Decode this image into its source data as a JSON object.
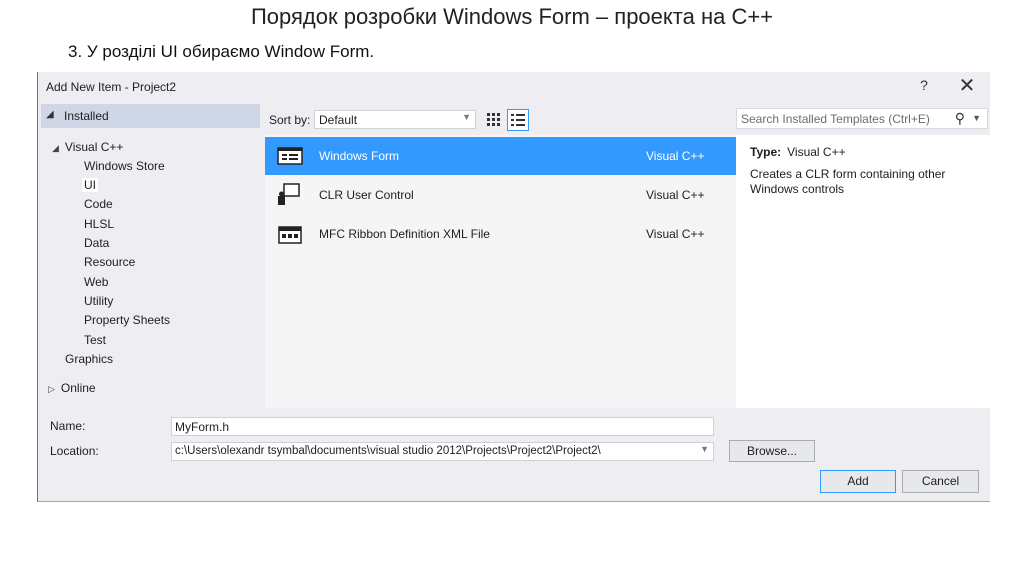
{
  "slide": {
    "title": "Порядок розробки  Windows Form – проекта на С++",
    "subtitle": "3. У розділі UI обираємо Window Form."
  },
  "dialog": {
    "title": "Add New Item - Project2",
    "help": "?",
    "close": "✕"
  },
  "tree": {
    "installed": "Installed",
    "visual_cpp": "Visual C++",
    "children": [
      "Windows Store",
      "UI",
      "Code",
      "HLSL",
      "Data",
      "Resource",
      "Web",
      "Utility",
      "Property Sheets",
      "Test"
    ],
    "graphics": "Graphics",
    "online": "Online",
    "selected": "UI"
  },
  "toolbar": {
    "sort_label": "Sort by:",
    "sort_value": "Default"
  },
  "templates": [
    {
      "name": "Windows Form",
      "lang": "Visual C++",
      "icon": "windows-form-icon",
      "selected": true
    },
    {
      "name": "CLR User Control",
      "lang": "Visual C++",
      "icon": "user-control-icon",
      "selected": false
    },
    {
      "name": "MFC Ribbon Definition XML File",
      "lang": "Visual C++",
      "icon": "ribbon-icon",
      "selected": false
    }
  ],
  "search": {
    "placeholder": "Search Installed Templates (Ctrl+E)"
  },
  "details": {
    "type_label": "Type:",
    "type_value": "Visual C++",
    "description": "Creates a CLR form containing other Windows controls"
  },
  "form": {
    "name_label": "Name:",
    "name_value": "MyForm.h",
    "location_label": "Location:",
    "location_value": "c:\\Users\\olexandr tsymbal\\documents\\visual studio 2012\\Projects\\Project2\\Project2\\",
    "browse": "Browse...",
    "add": "Add",
    "cancel": "Cancel"
  },
  "colors": {
    "selection": "#3399ff",
    "dialog_bg": "#eeeef2",
    "installed_bg": "#cfd6e5"
  }
}
